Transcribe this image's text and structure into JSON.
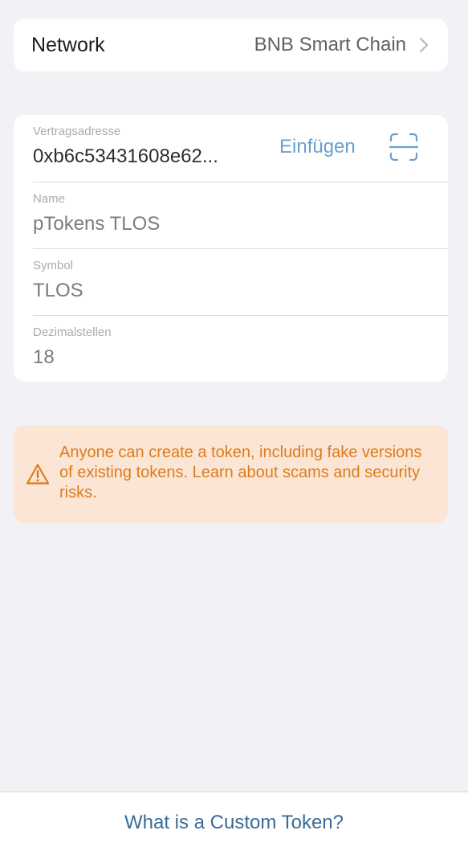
{
  "network": {
    "label": "Network",
    "value": "BNB Smart Chain"
  },
  "form": {
    "contract": {
      "label": "Vertragsadresse",
      "value": "0xb6c53431608e62...",
      "paste_label": "Einfügen"
    },
    "name": {
      "label": "Name",
      "value": "pTokens TLOS"
    },
    "symbol": {
      "label": "Symbol",
      "value": "TLOS"
    },
    "decimals": {
      "label": "Dezimalstellen",
      "value": "18"
    }
  },
  "warning": {
    "text": "Anyone can create a token, including fake versions of existing tokens. Learn about scams and security risks.",
    "color": "#df7a1a",
    "background": "#fbe6d6"
  },
  "footer": {
    "link_label": "What is a Custom Token?"
  },
  "icons": {
    "chevron": "chevron-right-icon",
    "scan": "qr-scan-icon",
    "warning": "warning-triangle-icon"
  },
  "colors": {
    "accent": "#6c9fce",
    "link": "#3b6b95",
    "background": "#f1f1f6"
  }
}
